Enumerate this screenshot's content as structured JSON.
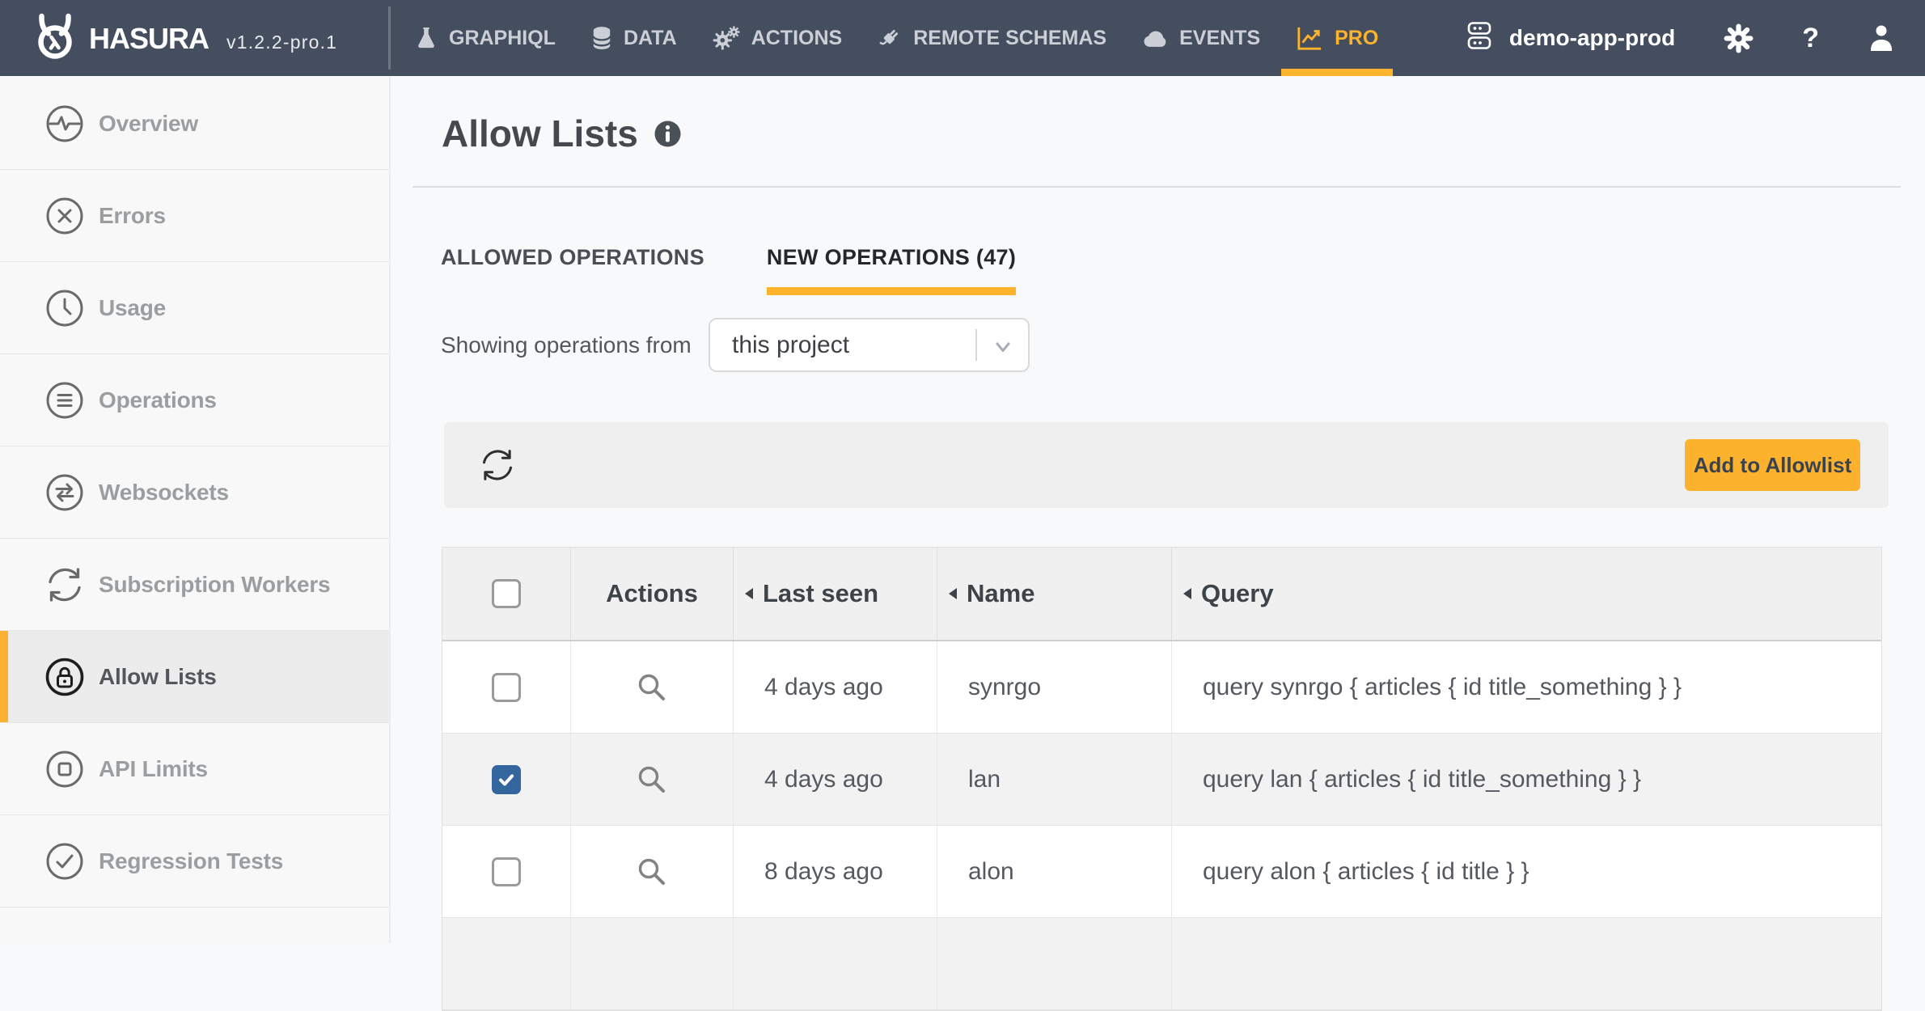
{
  "header": {
    "brand": "HASURA",
    "version": "v1.2.2-pro.1",
    "logo_icon": "owl",
    "nav": [
      {
        "label": "GRAPHIQL",
        "icon": "flask",
        "active": false
      },
      {
        "label": "DATA",
        "icon": "database",
        "active": false
      },
      {
        "label": "ACTIONS",
        "icon": "gears",
        "active": false
      },
      {
        "label": "REMOTE SCHEMAS",
        "icon": "plug",
        "active": false
      },
      {
        "label": "EVENTS",
        "icon": "cloud",
        "active": false
      },
      {
        "label": "PRO",
        "icon": "chart",
        "active": true
      }
    ],
    "project_name": "demo-app-prod",
    "project_icon": "server",
    "settings_icon": "gear",
    "help_label": "?",
    "user_icon": "person"
  },
  "sidebar": {
    "items": [
      {
        "label": "Overview",
        "icon": "pulse",
        "active": false
      },
      {
        "label": "Errors",
        "icon": "error",
        "active": false
      },
      {
        "label": "Usage",
        "icon": "clock",
        "active": false
      },
      {
        "label": "Operations",
        "icon": "list",
        "active": false
      },
      {
        "label": "Websockets",
        "icon": "arrows",
        "active": false
      },
      {
        "label": "Subscription Workers",
        "icon": "cycle",
        "active": false
      },
      {
        "label": "Allow Lists",
        "icon": "lock",
        "active": true
      },
      {
        "label": "API Limits",
        "icon": "square",
        "active": false
      },
      {
        "label": "Regression Tests",
        "icon": "check",
        "active": false
      }
    ]
  },
  "main": {
    "title": "Allow Lists",
    "info_icon": "info",
    "tabs": [
      {
        "label": "ALLOWED OPERATIONS",
        "active": false
      },
      {
        "label": "NEW OPERATIONS (47)",
        "active": true
      }
    ],
    "filter_label": "Showing operations from",
    "filter_value": "this project",
    "chevron_icon": "chevron-down",
    "refresh_icon": "refresh",
    "add_button": "Add to Allowlist",
    "table": {
      "action_icon": "magnifier",
      "check_icon": "checkmark",
      "columns": [
        "Actions",
        "Last seen",
        "Name",
        "Query"
      ],
      "rows": [
        {
          "checked": false,
          "last_seen": "4 days ago",
          "name": "synrgo",
          "query": "query synrgo { articles { id title_something } }",
          "highlighted": false,
          "partial": false
        },
        {
          "checked": true,
          "last_seen": "4 days ago",
          "name": "lan",
          "query": "query lan { articles { id title_something } }",
          "highlighted": true,
          "partial": false
        },
        {
          "checked": false,
          "last_seen": "8 days ago",
          "name": "alon",
          "query": "query alon { articles { id title } }",
          "highlighted": false,
          "partial": false
        },
        {
          "checked": false,
          "last_seen": "",
          "name": "",
          "query": "",
          "highlighted": true,
          "partial": true
        }
      ]
    }
  },
  "colors": {
    "accent": "#fdb32c",
    "header_bg": "#444e5f",
    "checkbox_checked": "#33669d"
  }
}
